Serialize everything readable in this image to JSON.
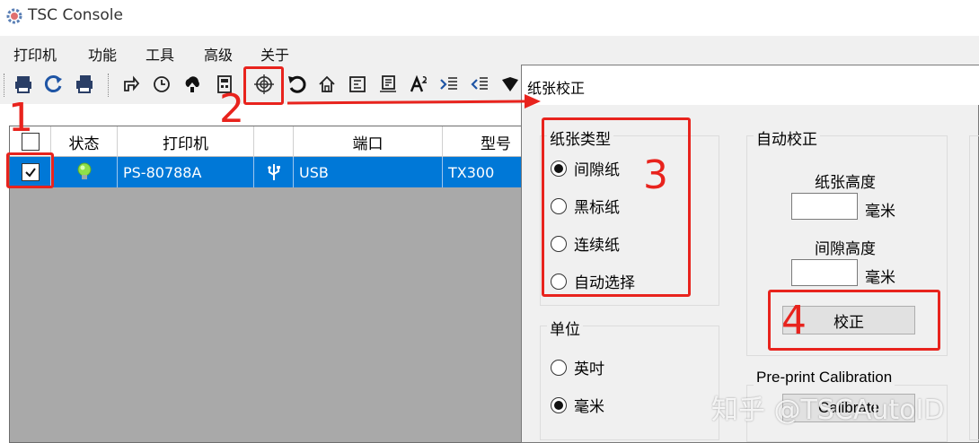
{
  "app": {
    "title": "TSC Console"
  },
  "menu": [
    "打印机",
    "功能",
    "工具",
    "高级",
    "关于"
  ],
  "toolbar": {
    "icons": [
      "printer-icon",
      "refresh-icon",
      "printer-stack-icon",
      "feed-icon",
      "clock-icon",
      "upload-icon",
      "calculator-icon",
      "calibrate-crosshair-icon",
      "undo-icon",
      "home-icon",
      "config-icon",
      "receipt-icon",
      "font-icon",
      "list-in-icon",
      "list-out-icon",
      "shield-icon"
    ]
  },
  "grid": {
    "columns": [
      "",
      "状态",
      "打印机",
      "",
      "端口",
      "型号"
    ],
    "rows": [
      {
        "checked": true,
        "status": "online",
        "printer": "PS-80788A",
        "port_icon": "usb-icon",
        "port": "USB",
        "model": "TX300"
      }
    ]
  },
  "dialog": {
    "title": "纸张校正",
    "paper_type": {
      "label": "纸张类型",
      "options": [
        "间隙纸",
        "黑标纸",
        "连续纸",
        "自动选择"
      ],
      "selected": 0
    },
    "unit": {
      "label": "单位",
      "options": [
        "英吋",
        "毫米"
      ],
      "selected": 1
    },
    "auto_calibration": {
      "label": "自动校正",
      "paper_height_label": "纸张高度",
      "paper_height_value": "",
      "paper_height_unit": "毫米",
      "gap_height_label": "间隙高度",
      "gap_height_value": "",
      "gap_height_unit": "毫米",
      "calibrate_label": "校正"
    },
    "preprint": {
      "label": "Pre-print Calibration",
      "button_label": "Calibrate"
    }
  },
  "annotations": {
    "n1": "1",
    "n2": "2",
    "n3": "3",
    "n4": "4",
    "color": "#e8231d"
  },
  "watermark": "知乎 @TSCAutoID"
}
